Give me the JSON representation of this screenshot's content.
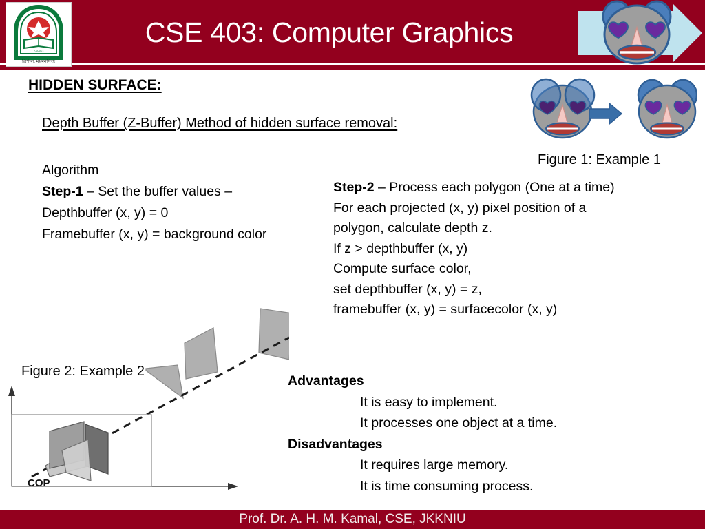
{
  "header": {
    "title": "CSE 403: Computer Graphics",
    "logo_name": "jkkniu-university-logo",
    "mascot_name": "face-on-arrow-graphic"
  },
  "content": {
    "section_heading": "HIDDEN SURFACE:",
    "subsection_heading": "Depth Buffer (Z-Buffer) Method of hidden surface removal:",
    "algorithm": {
      "title": "Algorithm",
      "step1_label": "Step-1",
      "step1_text": " – Set the buffer values –",
      "lines": [
        "Depthbuffer (x, y) = 0",
        "Framebuffer (x, y) = background color"
      ]
    },
    "step2": {
      "label": "Step-2",
      "headline": " – Process each polygon (One at a time)",
      "lines": [
        "For each projected (x, y) pixel position of a",
        "polygon, calculate depth z.",
        "If z > depthbuffer (x, y)",
        "Compute surface color,",
        "set depthbuffer (x, y) = z,",
        "framebuffer (x, y) = surfacecolor (x, y)"
      ]
    },
    "advantages": {
      "heading": "Advantages",
      "items": [
        "It is easy to implement.",
        "It processes one object at a time."
      ]
    },
    "disadvantages": {
      "heading": "Disadvantages",
      "items": [
        "It requires large memory.",
        "It is time consuming process."
      ]
    }
  },
  "figures": {
    "figure1_caption": "Figure 1: Example 1",
    "figure2_caption": "Figure 2: Example 2",
    "figure2_cop_label": "COP"
  },
  "footer": {
    "text": "Prof. Dr. A. H. M. Kamal, CSE, JKKNIU"
  },
  "colors": {
    "brand_maroon": "#93001e",
    "mascot_face": "#9e9e9e",
    "mascot_ear": "#4a7ebb",
    "heart_eye": "#6a2a9e",
    "arrow_blue": "#3a6fa8",
    "panel_light_blue": "#bfe3ee",
    "polygon_gray": "#b0b0b0"
  }
}
